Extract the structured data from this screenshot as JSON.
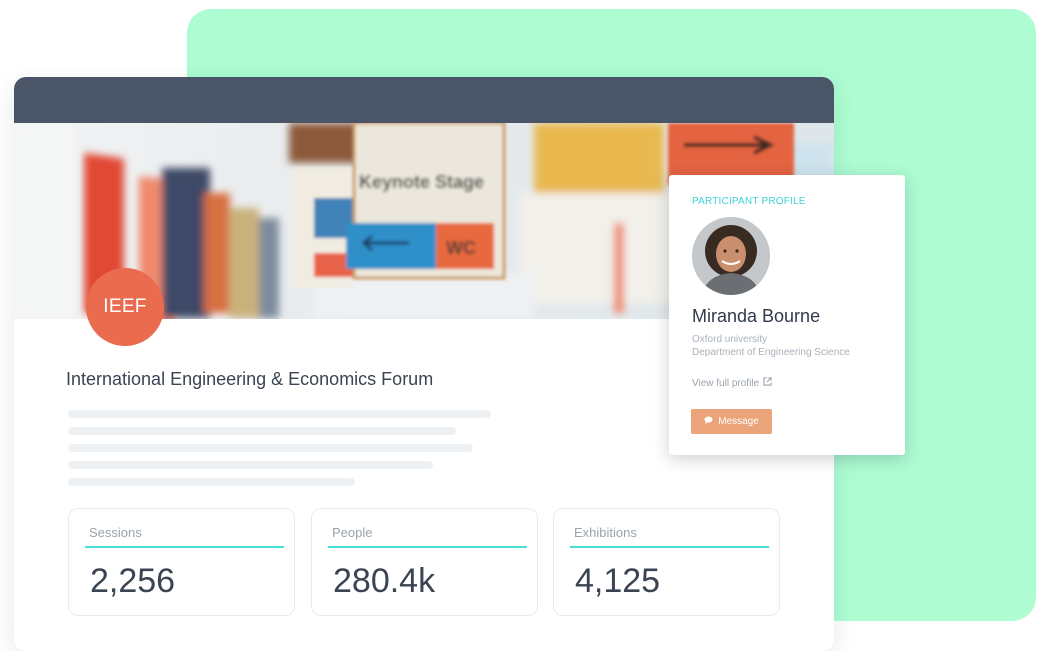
{
  "event": {
    "logo_text": "IEEF",
    "title": "International Engineering & Economics Forum",
    "banner_signs": {
      "keynote": "Keynote Stage",
      "wc": "WC"
    }
  },
  "stats": [
    {
      "label": "Sessions",
      "value": "2,256"
    },
    {
      "label": "People",
      "value": "280.4k"
    },
    {
      "label": "Exhibitions",
      "value": "4,125"
    }
  ],
  "profile": {
    "section_label": "PARTICIPANT PROFILE",
    "name": "Miranda Bourne",
    "organization": "Oxford university",
    "department": "Department of Engineering Science",
    "view_link": "View full profile",
    "message_button": "Message"
  },
  "colors": {
    "backdrop_green": "#adfcd2",
    "topbar": "#4a5568",
    "logo_orange": "#ea6b4e",
    "accent_teal": "#47dfd6",
    "message_button": "#eba47a"
  },
  "icons": {
    "external_link": "external-link-icon",
    "message": "chat-bubble-icon"
  }
}
